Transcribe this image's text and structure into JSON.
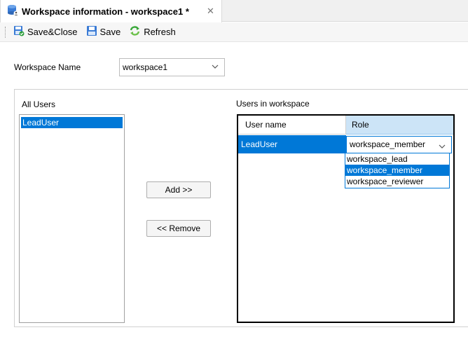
{
  "tab": {
    "title": "Workspace information - workspace1 *",
    "close_glyph": "✕",
    "icon": "database-workspace-icon"
  },
  "toolbar": {
    "save_close_label": "Save&Close",
    "save_label": "Save",
    "refresh_label": "Refresh"
  },
  "workspace": {
    "name_label": "Workspace Name",
    "name_value": "workspace1"
  },
  "all_users": {
    "label": "All Users",
    "items": [
      "LeadUser"
    ]
  },
  "buttons": {
    "add_label": "Add >>",
    "remove_label": "<< Remove"
  },
  "users_in_workspace": {
    "label": "Users in workspace",
    "columns": [
      "User name",
      "Role"
    ],
    "rows": [
      {
        "user": "LeadUser",
        "role": "workspace_member"
      }
    ]
  },
  "role_dropdown": {
    "options": [
      "workspace_lead",
      "workspace_member",
      "workspace_reviewer"
    ],
    "selected": "workspace_member"
  },
  "colors": {
    "selection": "#0078d7",
    "header_highlight": "#cce4f7"
  }
}
